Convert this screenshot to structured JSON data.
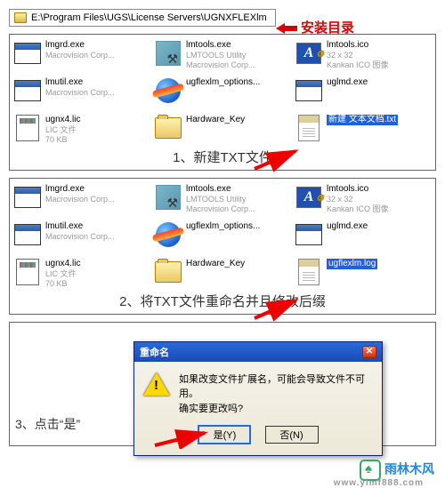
{
  "path_bar": "E:\\Program Files\\UGS\\License Servers\\UGNXFLEXlm",
  "annotations": {
    "install_dir": "安装目录",
    "step1": "1、新建TXT文件",
    "step2": "2、将TXT文件重命名并且修改后缀",
    "step3_prefix": "3、点击“是”"
  },
  "panel1": {
    "items": [
      {
        "name": "lmgrd.exe",
        "line2": "Macrovision Corp..."
      },
      {
        "name": "lmtools.exe",
        "line2": "LMTOOLS Utility",
        "line3": "Macrovision Corp..."
      },
      {
        "name": "lmtools.ico",
        "line2": "32 x 32",
        "line3": "Kankan ICO 图像"
      },
      {
        "name": "lmutil.exe",
        "line2": "Macrovision Corp..."
      },
      {
        "name": "ugflexlm_options...",
        "line2": ""
      },
      {
        "name": "uglmd.exe",
        "line2": ""
      },
      {
        "name": "ugnx4.lic",
        "line2": "LIC 文件",
        "line3": "70 KB"
      },
      {
        "name": "Hardware_Key",
        "line2": ""
      },
      {
        "name_highlight": "新建 文本文档.txt"
      }
    ]
  },
  "panel2": {
    "items": [
      {
        "name": "lmgrd.exe",
        "line2": "Macrovision Corp..."
      },
      {
        "name": "lmtools.exe",
        "line2": "LMTOOLS Utility",
        "line3": "Macrovision Corp..."
      },
      {
        "name": "lmtools.ico",
        "line2": "32 x 32",
        "line3": "Kankan ICO 图像"
      },
      {
        "name": "lmutil.exe",
        "line2": "Macrovision Corp..."
      },
      {
        "name": "ugflexlm_options...",
        "line2": ""
      },
      {
        "name": "uglmd.exe",
        "line2": ""
      },
      {
        "name": "ugnx4.lic",
        "line2": "LIC 文件",
        "line3": "70 KB"
      },
      {
        "name": "Hardware_Key",
        "line2": ""
      },
      {
        "name_highlight": "ugflexlm.log"
      }
    ]
  },
  "dialog": {
    "title": "重命名",
    "msg1": "如果改变文件扩展名，可能会导致文件不可用。",
    "msg2": "确实要更改吗?",
    "yes": "是(Y)",
    "no": "否(N)"
  },
  "logo": {
    "brand": "雨林木风",
    "url": "www.ylmf888.com"
  }
}
